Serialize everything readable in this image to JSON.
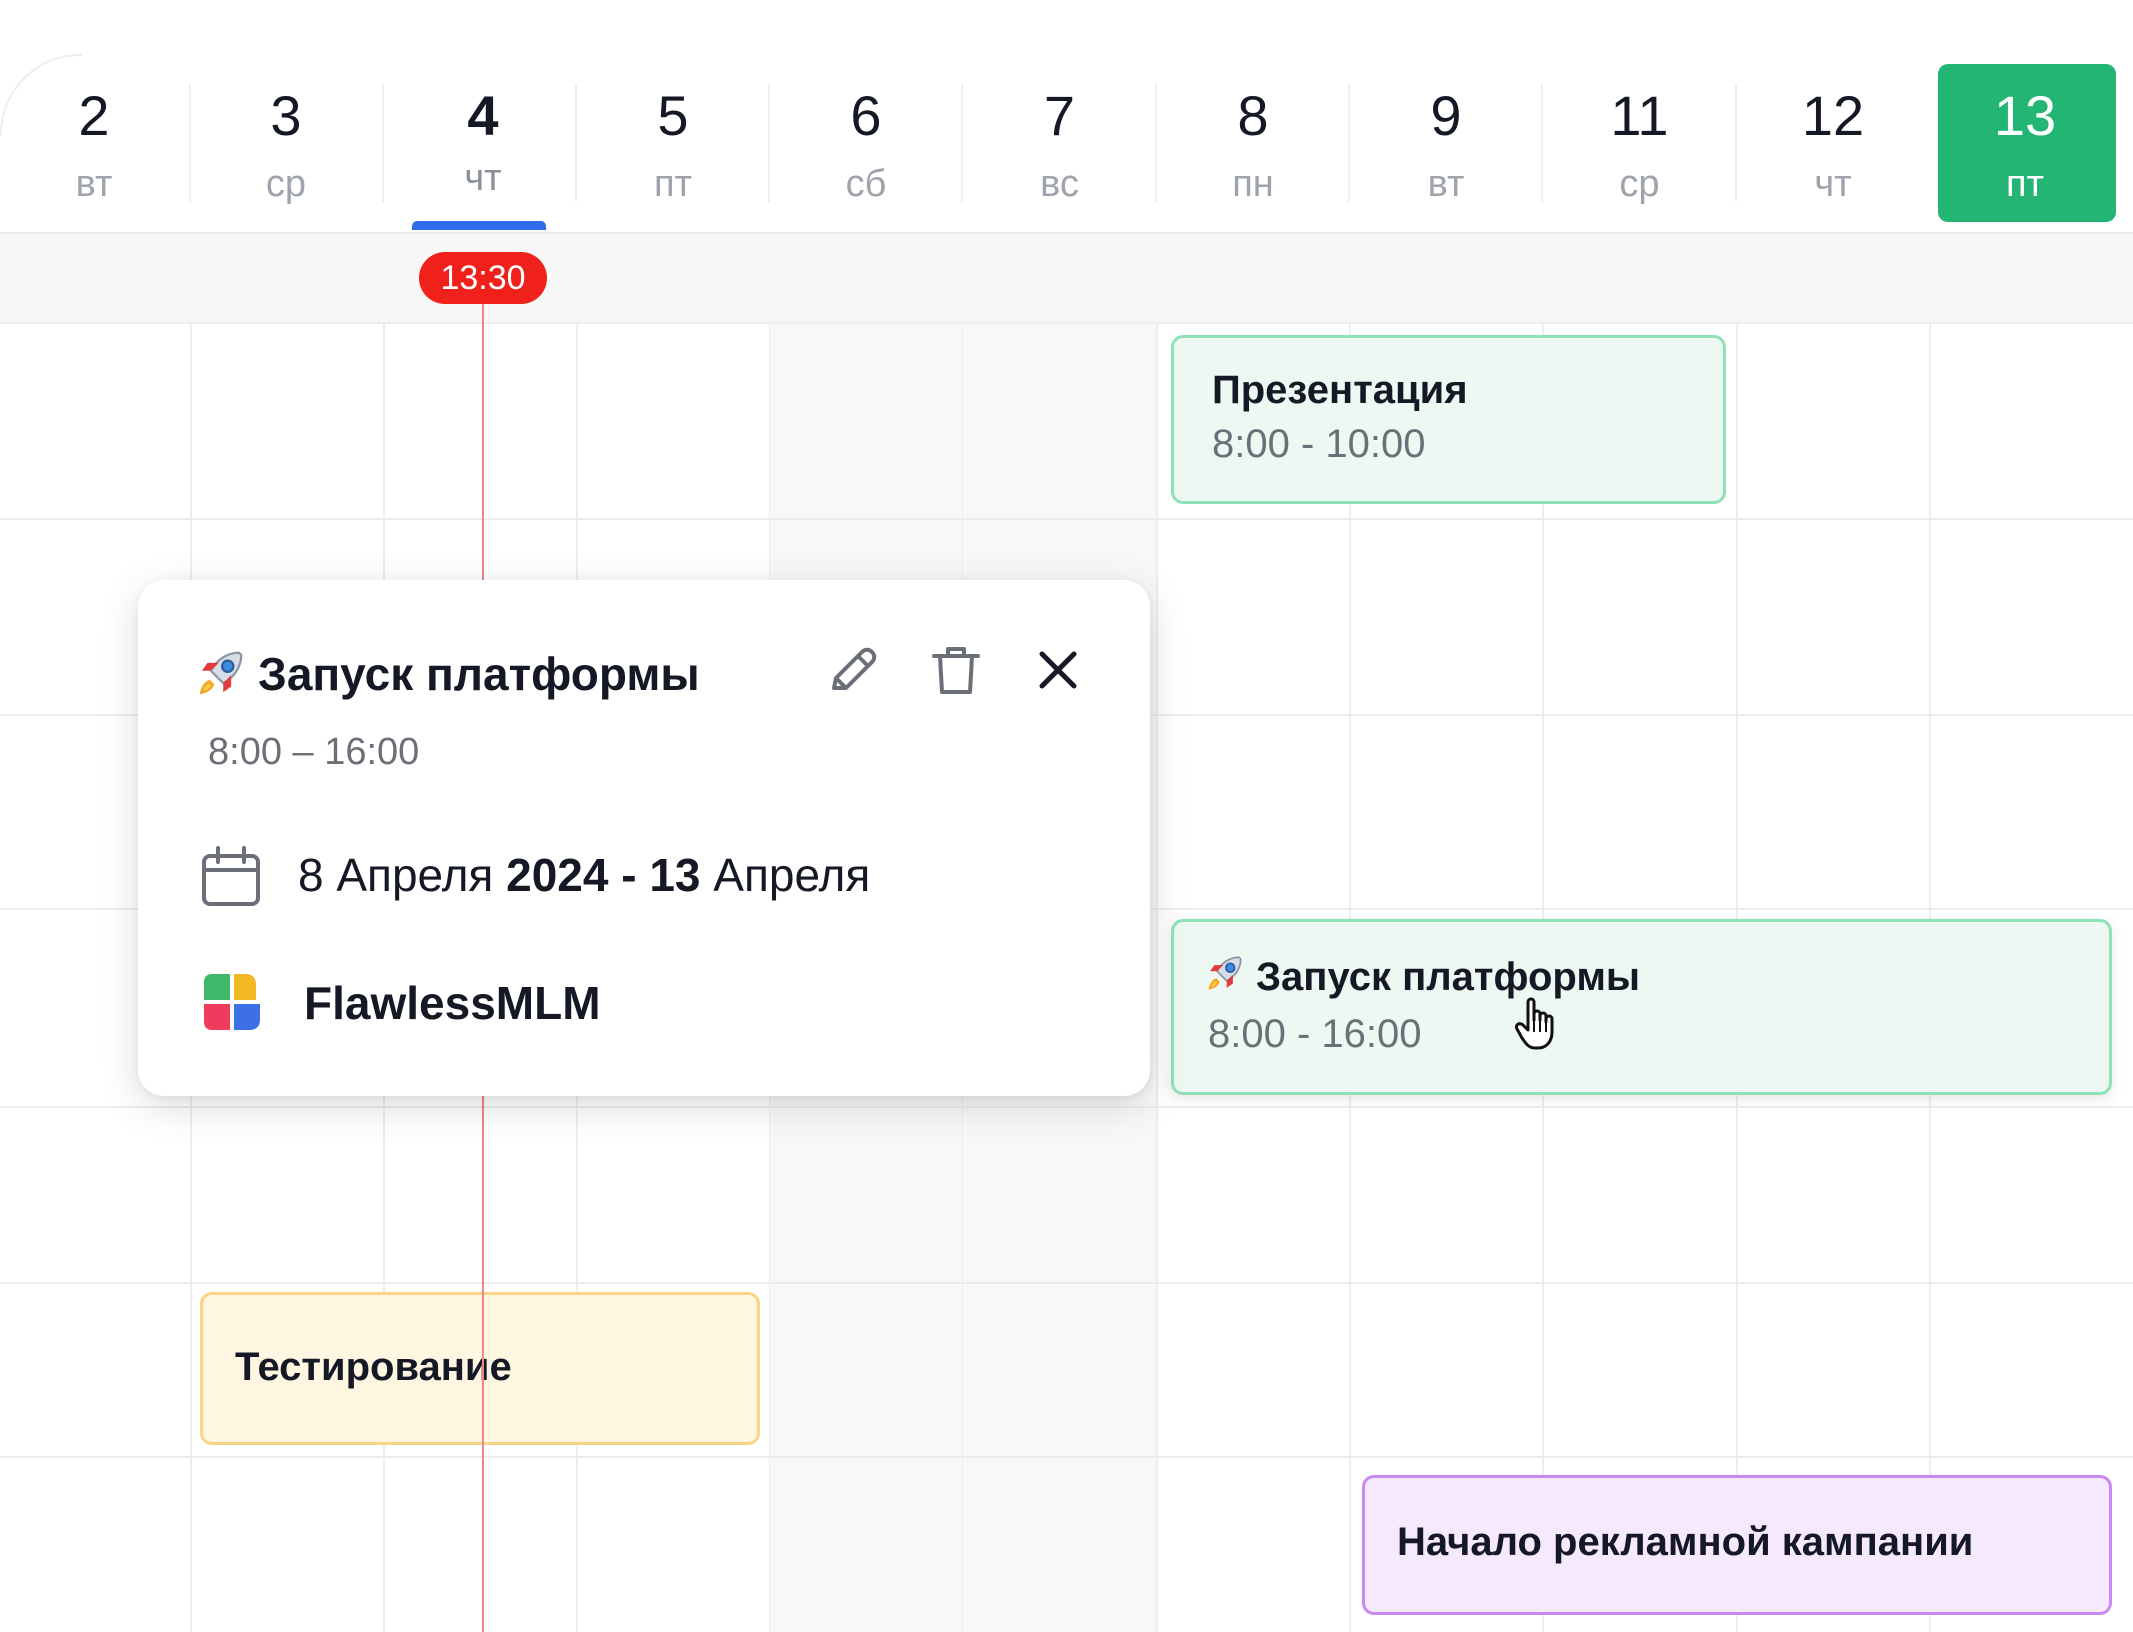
{
  "header": {
    "days": [
      {
        "num": "2",
        "dow": "вт"
      },
      {
        "num": "3",
        "dow": "ср"
      },
      {
        "num": "4",
        "dow": "чт"
      },
      {
        "num": "5",
        "dow": "пт"
      },
      {
        "num": "6",
        "dow": "сб"
      },
      {
        "num": "7",
        "dow": "вс"
      },
      {
        "num": "8",
        "dow": "пн"
      },
      {
        "num": "9",
        "dow": "вт"
      },
      {
        "num": "11",
        "dow": "ср"
      },
      {
        "num": "12",
        "dow": "чт"
      },
      {
        "num": "13",
        "dow": "пт"
      }
    ],
    "today_index": 2,
    "selected_index": 10
  },
  "now_indicator": {
    "time": "13:30",
    "color": "#f0201a"
  },
  "events": {
    "presentation": {
      "title": "Презентация",
      "time": "8:00 - 10:00"
    },
    "launch": {
      "title": "Запуск платформы",
      "time": "8:00 - 16:00",
      "icon": "rocket-icon"
    },
    "testing": {
      "title": "Тестирование"
    },
    "ad_campaign": {
      "title": "Начало рекламной кампании"
    }
  },
  "popup": {
    "title": "Запуск платформы",
    "time": "8:00 – 16:00",
    "date_part1": "8 Апреля ",
    "date_part2": "2024 - 13",
    "date_part3": " Апреля",
    "organization": "FlawlessMLM",
    "icons": {
      "title": "rocket-icon",
      "edit": "pencil-icon",
      "delete": "trash-icon",
      "close": "close-icon",
      "date": "calendar-icon",
      "org": "flawlessmlm-logo"
    }
  },
  "colors": {
    "selected_day": "#22b573",
    "today_underline": "#2f6bea",
    "now_badge": "#f0201a",
    "green_event": "#ecf8f1",
    "yellow_event": "#fff6e2",
    "purple_event": "#f6e8ff"
  }
}
